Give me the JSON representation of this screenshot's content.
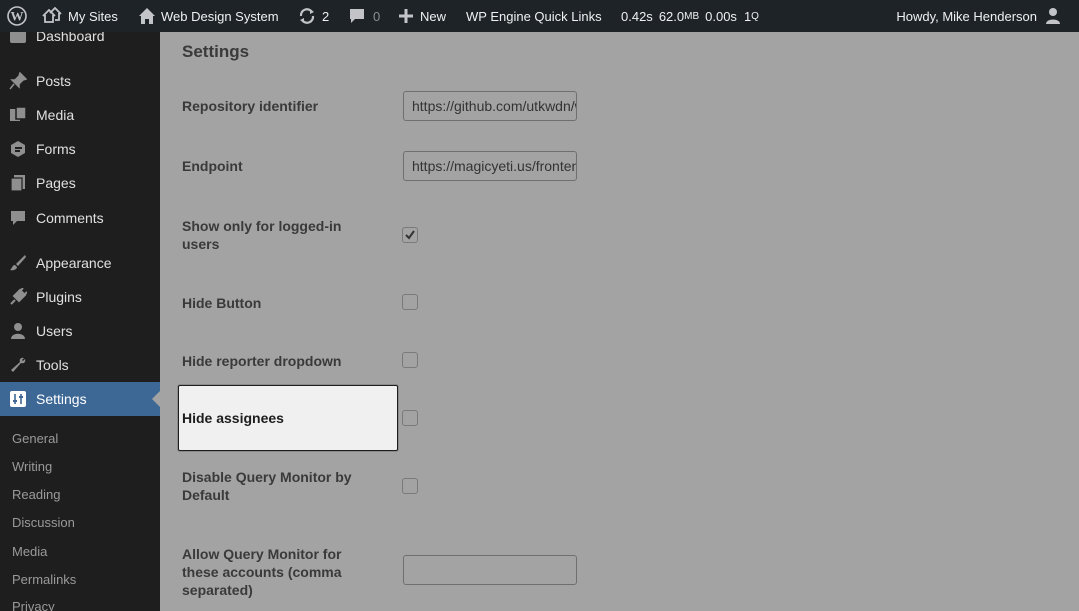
{
  "adminbar": {
    "my_sites": "My Sites",
    "site_name": "Web Design System",
    "updates_count": "2",
    "comments_count": "0",
    "new_label": "New",
    "quick_links": "WP Engine Quick Links",
    "qm_time": "0.42s",
    "qm_memory": "62.0",
    "qm_memory_unit": "MB",
    "qm_db_time": "0.00s",
    "qm_queries": "1",
    "qm_queries_unit": "Q",
    "howdy": "Howdy, Mike Henderson"
  },
  "sidebar": {
    "items": [
      {
        "label": "Dashboard",
        "icon": "dashboard-icon"
      },
      {
        "label": "Posts",
        "icon": "pin-icon"
      },
      {
        "label": "Media",
        "icon": "media-icon"
      },
      {
        "label": "Forms",
        "icon": "forms-icon"
      },
      {
        "label": "Pages",
        "icon": "pages-icon"
      },
      {
        "label": "Comments",
        "icon": "comment-icon"
      },
      {
        "label": "Appearance",
        "icon": "brush-icon"
      },
      {
        "label": "Plugins",
        "icon": "plug-icon"
      },
      {
        "label": "Users",
        "icon": "user-icon"
      },
      {
        "label": "Tools",
        "icon": "wrench-icon"
      },
      {
        "label": "Settings",
        "icon": "sliders-icon",
        "current": true
      }
    ],
    "submenu": [
      "General",
      "Writing",
      "Reading",
      "Discussion",
      "Media",
      "Permalinks",
      "Privacy"
    ]
  },
  "main": {
    "heading": "Settings",
    "fields": {
      "repository": {
        "label": "Repository identifier",
        "value": "https://github.com/utkwdn/wds"
      },
      "endpoint": {
        "label": "Endpoint",
        "value": "https://magicyeti.us/frontend"
      },
      "logged_in": {
        "label": "Show only for logged-in users",
        "checked": true
      },
      "hide_button": {
        "label": "Hide Button",
        "checked": false
      },
      "hide_reporter": {
        "label": "Hide reporter dropdown",
        "checked": false
      },
      "hide_assignees": {
        "label": "Hide assignees",
        "checked": false
      },
      "disable_qm": {
        "label": "Disable Query Monitor by Default",
        "checked": false
      },
      "allow_qm": {
        "label": "Allow Query Monitor for these accounts (comma separated)",
        "value": ""
      }
    }
  },
  "colors": {
    "adminbar_bg": "#1d2327",
    "sidebar_bg": "#1e1e1e",
    "current_menu_bg": "#3d6896",
    "overlay_bg": "#a3a3a3",
    "highlight_bg": "#f0f0f0"
  }
}
